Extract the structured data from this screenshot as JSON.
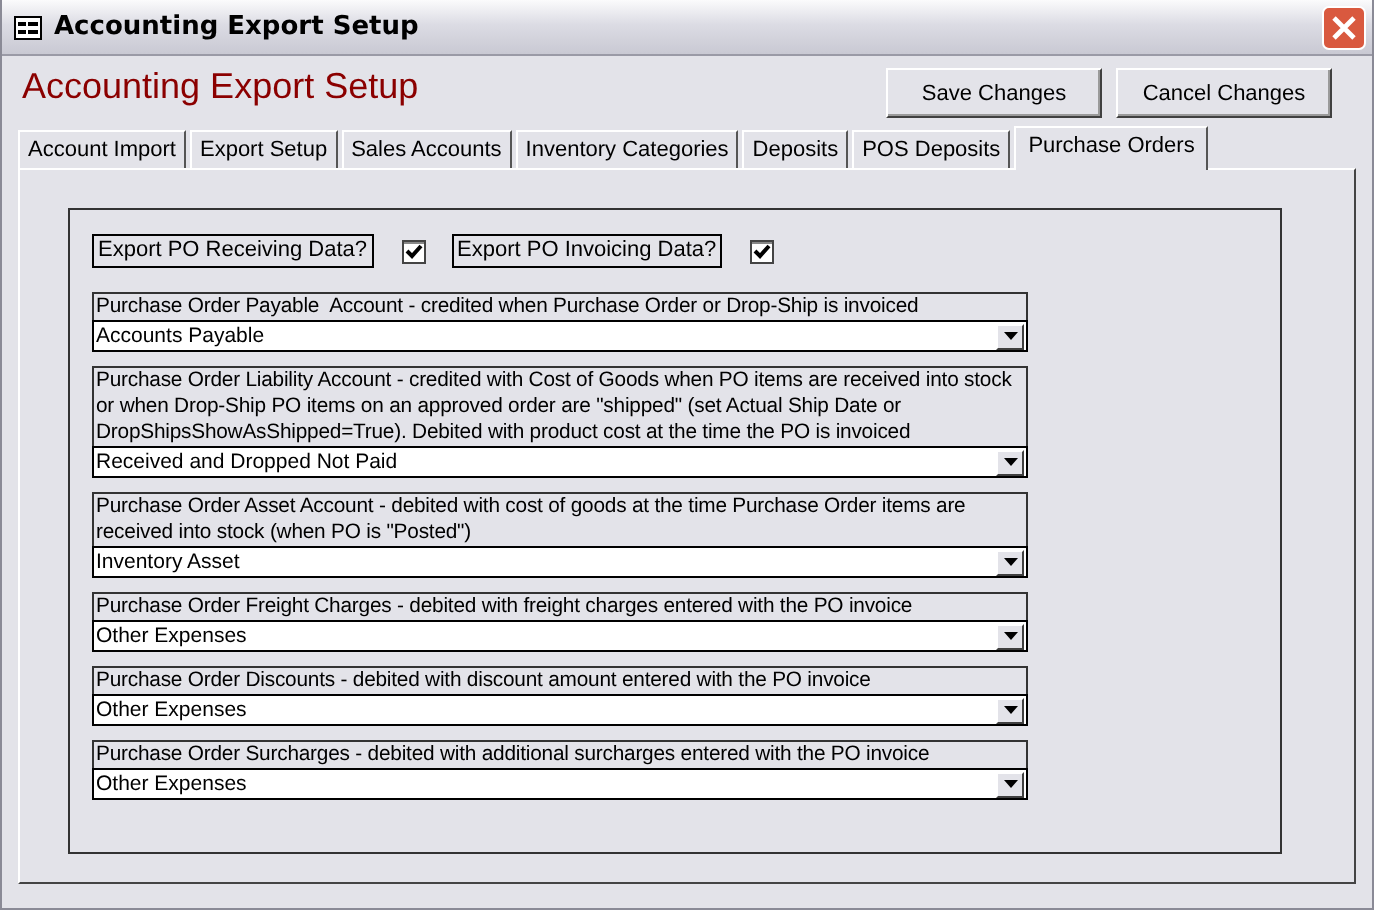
{
  "window": {
    "title": "Accounting Export Setup"
  },
  "heading": "Accounting Export Setup",
  "buttons": [
    {
      "label": "Save Changes"
    },
    {
      "label": "Cancel Changes"
    }
  ],
  "tabs": [
    {
      "label": "Account Import",
      "selected": false
    },
    {
      "label": "Export Setup",
      "selected": false
    },
    {
      "label": "Sales Accounts",
      "selected": false
    },
    {
      "label": "Inventory Categories",
      "selected": false
    },
    {
      "label": "Deposits",
      "selected": false
    },
    {
      "label": "POS Deposits",
      "selected": false
    },
    {
      "label": "Purchase Orders",
      "selected": true
    }
  ],
  "checkboxes": [
    {
      "label": "Export PO Receiving Data?",
      "checked": true
    },
    {
      "label": "Export PO Invoicing Data?",
      "checked": true
    }
  ],
  "accounts": [
    {
      "description": "Purchase Order Payable  Account - credited when Purchase Order or Drop-Ship is invoiced",
      "value": "Accounts Payable"
    },
    {
      "description": "Purchase Order Liability Account - credited with Cost of Goods when PO items are received into stock or when Drop-Ship PO items on an approved order are \"shipped\" (set Actual Ship Date or DropShipsShowAsShipped=True). Debited with product cost at the time the PO is invoiced",
      "value": "Received and Dropped Not Paid"
    },
    {
      "description": "Purchase Order Asset Account - debited with cost of goods at the time Purchase Order items are received into stock (when PO is \"Posted\")",
      "value": "Inventory Asset"
    },
    {
      "description": "Purchase Order Freight Charges - debited with freight charges entered with the PO invoice",
      "value": "Other Expenses"
    },
    {
      "description": "Purchase Order Discounts - debited with discount amount entered with the PO invoice",
      "value": "Other Expenses"
    },
    {
      "description": "Purchase Order Surcharges - debited with additional surcharges entered with the PO invoice",
      "value": "Other Expenses"
    }
  ]
}
